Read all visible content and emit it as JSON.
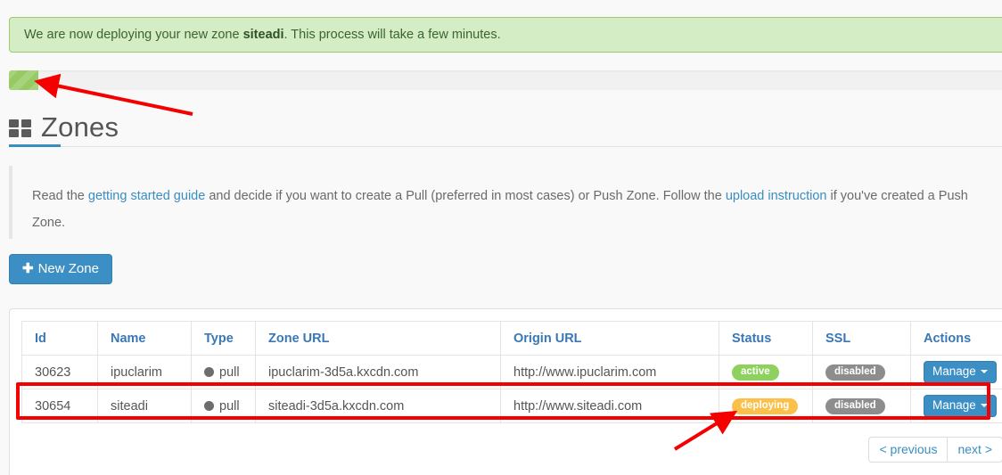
{
  "alert": {
    "text_before": "We are now deploying your new zone ",
    "zone_name": "siteadi",
    "text_after": ". This process will take a few minutes.",
    "color": "#d4edc4"
  },
  "progress": {
    "label": "deploy-progress",
    "percent": 3,
    "fill_color": "#95cb62"
  },
  "header": {
    "icon": "grid-icon",
    "title": "Zones",
    "accent_color": "#3a8dbf"
  },
  "description": {
    "part1": "Read the ",
    "link1": "getting started guide",
    "part2": " and decide if you want to create a Pull (preferred in most cases) or Push Zone. Follow the ",
    "link2": "upload instruction",
    "part3": " if you've created a Push Zone."
  },
  "toolbar": {
    "new_zone_label": "New Zone",
    "new_zone_icon": "plus-icon",
    "button_color": "#3b8fc4"
  },
  "table": {
    "columns": [
      "Id",
      "Name",
      "Type",
      "Zone URL",
      "Origin URL",
      "Status",
      "SSL",
      "Actions"
    ],
    "rows": [
      {
        "id": "30623",
        "name": "ipuclarim",
        "type": "pull",
        "zone_url": "ipuclarim-3d5a.kxcdn.com",
        "origin_url": "http://www.ipuclarim.com",
        "status": "active",
        "status_color": "#8ed15e",
        "ssl": "disabled",
        "action": "Manage",
        "highlighted": false
      },
      {
        "id": "30654",
        "name": "siteadi",
        "type": "pull",
        "zone_url": "siteadi-3d5a.kxcdn.com",
        "origin_url": "http://www.siteadi.com",
        "status": "deploying",
        "status_color": "#fbc04a",
        "ssl": "disabled",
        "action": "Manage",
        "highlighted": true
      }
    ]
  },
  "pagination": {
    "previous_label": "< previous",
    "next_label": "next >"
  },
  "annotations": {
    "highlight_color": "#f40000",
    "arrow_top_target": "deploy-progress-bar",
    "arrow_bottom_target": "deploying-status-badge"
  }
}
